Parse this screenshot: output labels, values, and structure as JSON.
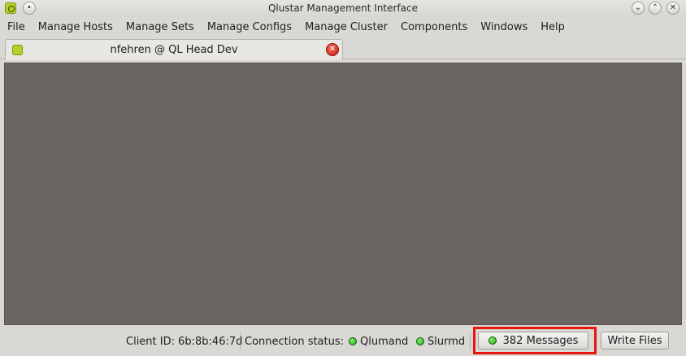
{
  "window": {
    "title": "Qlustar Management Interface",
    "icons": {
      "app": "qlustar-logo-icon",
      "menu": "window-menu-dot-icon",
      "minimize": "chevron-down-icon",
      "maximize": "chevron-up-icon",
      "close": "close-x-icon"
    }
  },
  "menubar": {
    "items": [
      "File",
      "Manage Hosts",
      "Manage Sets",
      "Manage Configs",
      "Manage Cluster",
      "Components",
      "Windows",
      "Help"
    ]
  },
  "tabs": [
    {
      "label": "nfehren @ QL Head Dev",
      "icon": "qlustar-logo-icon",
      "close_icon": "close-circle-icon"
    }
  ],
  "statusbar": {
    "client_id": "Client ID: 6b:8b:46:7d",
    "connection_label": "Connection status:",
    "services": [
      {
        "name": "Qlumand",
        "status_color": "#22b022"
      },
      {
        "name": "Slurmd",
        "status_color": "#22b022"
      }
    ],
    "messages_label": "382 Messages",
    "write_files_label": "Write Files"
  },
  "colors": {
    "canvas": "#6b6662",
    "highlight": "#e8160c",
    "status_ok": "#22b022"
  }
}
